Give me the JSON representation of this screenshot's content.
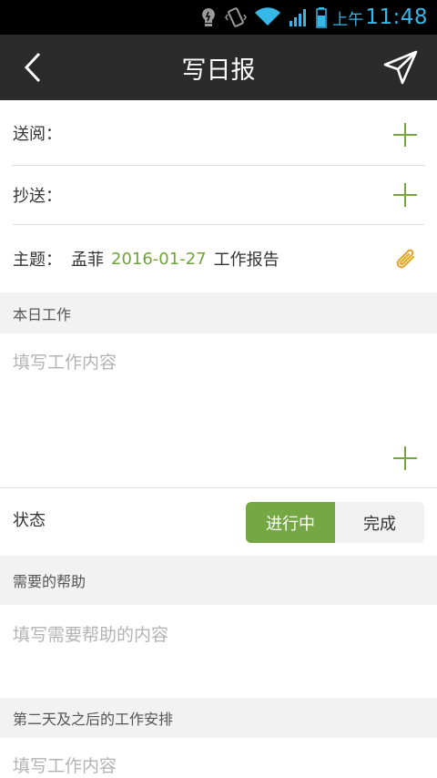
{
  "status_bar": {
    "ampm": "上午",
    "time": "11:48",
    "icons": [
      "lightbulb-icon",
      "vibrate-icon",
      "wifi-icon",
      "signal-icon",
      "battery-icon"
    ]
  },
  "header": {
    "title": "写日报",
    "back_icon": "back-chevron-icon",
    "send_icon": "send-icon"
  },
  "form": {
    "reviewer_label": "送阅：",
    "cc_label": "抄送：",
    "subject_label": "主题：",
    "subject_name": "孟菲",
    "subject_date": "2016-01-27",
    "subject_suffix": "工作报告",
    "attachment_icon": "paperclip-icon",
    "today_section": "本日工作",
    "today_placeholder": "填写工作内容",
    "status_label": "状态",
    "status_options": [
      "进行中",
      "完成"
    ],
    "status_selected": "进行中",
    "help_section": "需要的帮助",
    "help_placeholder": "填写需要帮助的内容",
    "next_section": "第二天及之后的工作安排",
    "next_placeholder": "填写工作内容"
  },
  "colors": {
    "accent": "#75a845",
    "header_bg": "#2b2b2b",
    "status_blue": "#35b7e8"
  }
}
